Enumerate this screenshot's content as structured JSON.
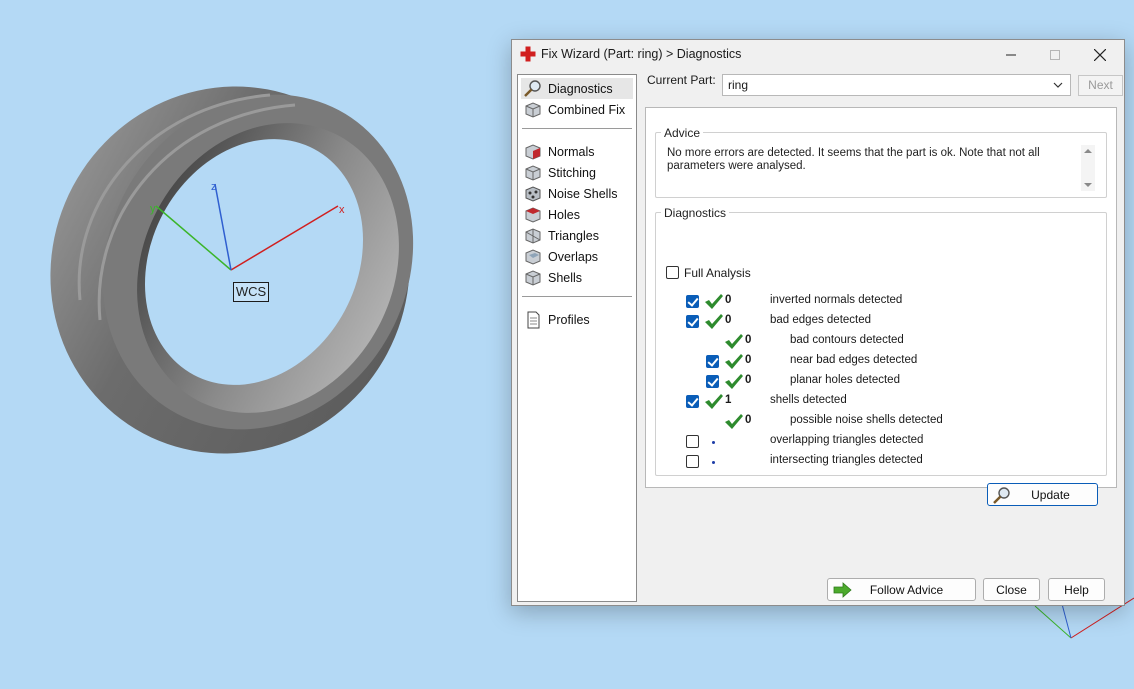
{
  "viewport": {
    "wcs_label": "WCS",
    "axis_colors": {
      "x": "#d11f1f",
      "y": "#3bb52a",
      "z": "#2f5fd0"
    },
    "axis_letters": {
      "x": "x",
      "y": "y",
      "z": "z"
    },
    "ring_color": "#6e6e6e",
    "background": "#b4d9f5"
  },
  "window": {
    "title": "Fix Wizard (Part: ring) > Diagnostics",
    "controls": {
      "minimize": "minimize-icon",
      "maximize": "maximize-icon",
      "close": "close-icon"
    }
  },
  "nav": {
    "items": [
      {
        "label": "Diagnostics",
        "icon": "magnifier-icon",
        "selected": true
      },
      {
        "label": "Combined Fix",
        "icon": "cube-icon"
      },
      {
        "label": "Normals",
        "icon": "normals-cube-icon"
      },
      {
        "label": "Stitching",
        "icon": "stitching-cube-icon"
      },
      {
        "label": "Noise Shells",
        "icon": "noise-shells-icon"
      },
      {
        "label": "Holes",
        "icon": "holes-cube-icon"
      },
      {
        "label": "Triangles",
        "icon": "triangles-icon"
      },
      {
        "label": "Overlaps",
        "icon": "overlaps-icon"
      },
      {
        "label": "Shells",
        "icon": "shells-icon"
      },
      {
        "label": "Profiles",
        "icon": "document-icon"
      }
    ]
  },
  "part": {
    "label": "Current Part:",
    "value": "ring",
    "next_label": "Next"
  },
  "advice": {
    "title": "Advice",
    "text": "No more errors are detected. It seems that the part is ok. Note that not all parameters were analysed."
  },
  "diagnostics": {
    "title": "Diagnostics",
    "full_analysis_label": "Full Analysis",
    "full_analysis_checked": false,
    "rows": [
      {
        "checked": true,
        "status": "ok",
        "count": "0",
        "label": "inverted normals detected",
        "indent": 0
      },
      {
        "checked": true,
        "status": "ok",
        "count": "0",
        "label": "bad edges detected",
        "indent": 0
      },
      {
        "checked": null,
        "status": "ok",
        "count": "0",
        "label": "bad contours detected",
        "indent": 1
      },
      {
        "checked": true,
        "status": "ok",
        "count": "0",
        "label": "near bad edges detected",
        "indent": 1
      },
      {
        "checked": true,
        "status": "ok",
        "count": "0",
        "label": "planar holes detected",
        "indent": 1
      },
      {
        "checked": true,
        "status": "ok",
        "count": "1",
        "label": "shells detected",
        "indent": 0
      },
      {
        "checked": null,
        "status": "ok",
        "count": "0",
        "label": "possible noise shells detected",
        "indent": 1
      },
      {
        "checked": false,
        "status": "pending",
        "count": "",
        "label": "overlapping triangles detected",
        "indent": 0
      },
      {
        "checked": false,
        "status": "pending",
        "count": "",
        "label": "intersecting triangles detected",
        "indent": 0
      }
    ],
    "update_label": "Update"
  },
  "footer": {
    "follow_advice": "Follow Advice",
    "close": "Close",
    "help": "Help"
  },
  "colors": {
    "check_green": "#2e8b2e",
    "checkbox_blue": "#0a5db8",
    "accent_red": "#d11f1f"
  }
}
